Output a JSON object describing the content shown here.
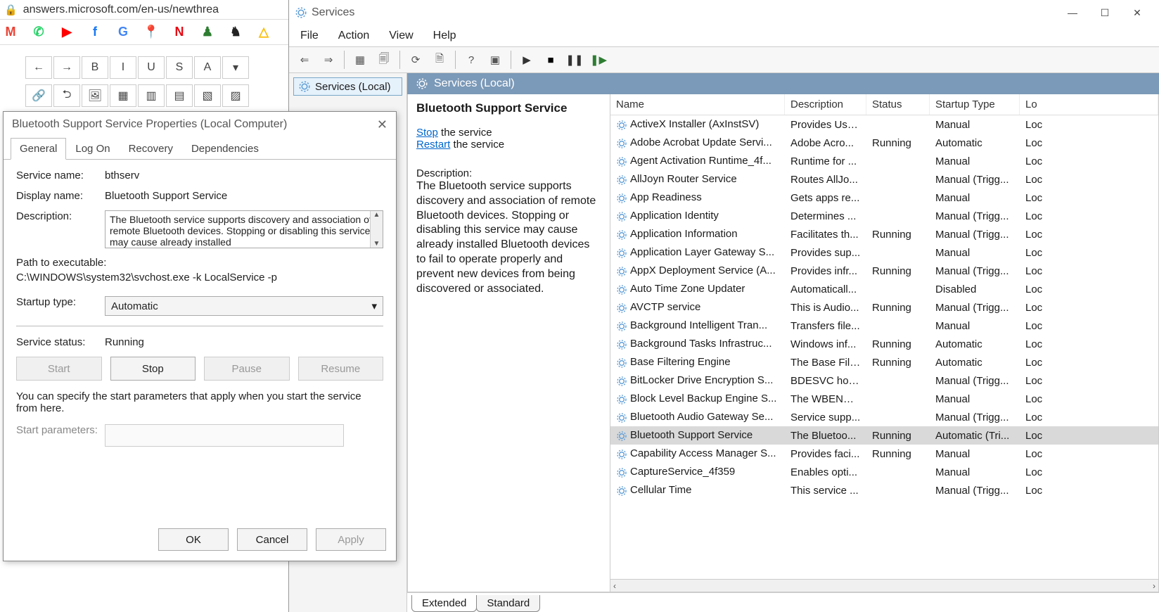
{
  "browser": {
    "url": "answers.microsoft.com/en-us/newthrea",
    "bookmarks": [
      {
        "name": "google-maps",
        "glyph": "M",
        "color": "#ea4335"
      },
      {
        "name": "whatsapp",
        "glyph": "✆",
        "color": "#25d366"
      },
      {
        "name": "youtube",
        "glyph": "▶",
        "color": "#ff0000"
      },
      {
        "name": "facebook",
        "glyph": "f",
        "color": "#1877f2"
      },
      {
        "name": "google-translate",
        "glyph": "G",
        "color": "#4285f4"
      },
      {
        "name": "maps-pin",
        "glyph": "📍",
        "color": "#ea4335"
      },
      {
        "name": "netflix",
        "glyph": "N",
        "color": "#e50914"
      },
      {
        "name": "chess-pawn",
        "glyph": "♟",
        "color": "#2e7d32"
      },
      {
        "name": "chess-knight",
        "glyph": "♞",
        "color": "#222"
      },
      {
        "name": "google-drive",
        "glyph": "△",
        "color": "#fbbc04"
      }
    ],
    "editor_toolbar": {
      "row1": [
        "←",
        "→",
        "B",
        "I",
        "U",
        "S",
        "A",
        "▾"
      ],
      "row2": [
        "🔗",
        "⮌",
        "🖼",
        "▦",
        "▥",
        "▤",
        "▧",
        "▨"
      ]
    }
  },
  "services_window": {
    "title": "Services",
    "menu": [
      "File",
      "Action",
      "View",
      "Help"
    ],
    "toolbar": [
      {
        "name": "back",
        "glyph": "⇐"
      },
      {
        "name": "forward",
        "glyph": "⇒"
      },
      {
        "sep": true
      },
      {
        "name": "show-hide-tree",
        "glyph": "▦"
      },
      {
        "name": "export-list",
        "glyph": "🗐"
      },
      {
        "sep": true
      },
      {
        "name": "refresh",
        "glyph": "⟳"
      },
      {
        "name": "properties",
        "glyph": "🗎"
      },
      {
        "sep": true
      },
      {
        "name": "help",
        "glyph": "?"
      },
      {
        "name": "action-pane",
        "glyph": "▣"
      },
      {
        "sep": true
      },
      {
        "name": "start",
        "glyph": "▶",
        "color": "#333"
      },
      {
        "name": "stop",
        "glyph": "■",
        "color": "#000"
      },
      {
        "name": "pause",
        "glyph": "❚❚",
        "color": "#333"
      },
      {
        "name": "restart",
        "glyph": "❚▶",
        "color": "#2e7d32"
      }
    ],
    "tree_node": "Services (Local)",
    "header": "Services (Local)",
    "detail": {
      "selected": "Bluetooth Support Service",
      "stop_link": "Stop",
      "stop_suffix": " the service",
      "restart_link": "Restart",
      "restart_suffix": " the service",
      "desc_label": "Description:",
      "desc_text": "The Bluetooth service supports discovery and association of remote Bluetooth devices.  Stopping or disabling this service may cause already installed Bluetooth devices to fail to operate properly and prevent new devices from being discovered or associated."
    },
    "columns": [
      "Name",
      "Description",
      "Status",
      "Startup Type",
      "Lo"
    ],
    "rows": [
      {
        "name": "ActiveX Installer (AxInstSV)",
        "desc": "Provides Use...",
        "status": "",
        "startup": "Manual",
        "log": "Loc"
      },
      {
        "name": "Adobe Acrobat Update Servi...",
        "desc": "Adobe Acro...",
        "status": "Running",
        "startup": "Automatic",
        "log": "Loc"
      },
      {
        "name": "Agent Activation Runtime_4f...",
        "desc": "Runtime for ...",
        "status": "",
        "startup": "Manual",
        "log": "Loc"
      },
      {
        "name": "AllJoyn Router Service",
        "desc": "Routes AllJo...",
        "status": "",
        "startup": "Manual (Trigg...",
        "log": "Loc"
      },
      {
        "name": "App Readiness",
        "desc": "Gets apps re...",
        "status": "",
        "startup": "Manual",
        "log": "Loc"
      },
      {
        "name": "Application Identity",
        "desc": "Determines ...",
        "status": "",
        "startup": "Manual (Trigg...",
        "log": "Loc"
      },
      {
        "name": "Application Information",
        "desc": "Facilitates th...",
        "status": "Running",
        "startup": "Manual (Trigg...",
        "log": "Loc"
      },
      {
        "name": "Application Layer Gateway S...",
        "desc": "Provides sup...",
        "status": "",
        "startup": "Manual",
        "log": "Loc"
      },
      {
        "name": "AppX Deployment Service (A...",
        "desc": "Provides infr...",
        "status": "Running",
        "startup": "Manual (Trigg...",
        "log": "Loc"
      },
      {
        "name": "Auto Time Zone Updater",
        "desc": "Automaticall...",
        "status": "",
        "startup": "Disabled",
        "log": "Loc"
      },
      {
        "name": "AVCTP service",
        "desc": "This is Audio...",
        "status": "Running",
        "startup": "Manual (Trigg...",
        "log": "Loc"
      },
      {
        "name": "Background Intelligent Tran...",
        "desc": "Transfers file...",
        "status": "",
        "startup": "Manual",
        "log": "Loc"
      },
      {
        "name": "Background Tasks Infrastruc...",
        "desc": "Windows inf...",
        "status": "Running",
        "startup": "Automatic",
        "log": "Loc"
      },
      {
        "name": "Base Filtering Engine",
        "desc": "The Base Filt...",
        "status": "Running",
        "startup": "Automatic",
        "log": "Loc"
      },
      {
        "name": "BitLocker Drive Encryption S...",
        "desc": "BDESVC hos...",
        "status": "",
        "startup": "Manual (Trigg...",
        "log": "Loc"
      },
      {
        "name": "Block Level Backup Engine S...",
        "desc": "The WBENGI...",
        "status": "",
        "startup": "Manual",
        "log": "Loc"
      },
      {
        "name": "Bluetooth Audio Gateway Se...",
        "desc": "Service supp...",
        "status": "",
        "startup": "Manual (Trigg...",
        "log": "Loc"
      },
      {
        "name": "Bluetooth Support Service",
        "desc": "The Bluetoo...",
        "status": "Running",
        "startup": "Automatic (Tri...",
        "log": "Loc",
        "selected": true
      },
      {
        "name": "Capability Access Manager S...",
        "desc": "Provides faci...",
        "status": "Running",
        "startup": "Manual",
        "log": "Loc"
      },
      {
        "name": "CaptureService_4f359",
        "desc": "Enables opti...",
        "status": "",
        "startup": "Manual",
        "log": "Loc"
      },
      {
        "name": "Cellular Time",
        "desc": "This service ...",
        "status": "",
        "startup": "Manual (Trigg...",
        "log": "Loc"
      }
    ],
    "tabs": [
      "Extended",
      "Standard"
    ],
    "active_tab": "Extended"
  },
  "properties_dialog": {
    "title": "Bluetooth Support Service Properties (Local Computer)",
    "tabs": [
      "General",
      "Log On",
      "Recovery",
      "Dependencies"
    ],
    "active_tab": "General",
    "service_name_lbl": "Service name:",
    "service_name": "bthserv",
    "display_name_lbl": "Display name:",
    "display_name": "Bluetooth Support Service",
    "description_lbl": "Description:",
    "description": "The Bluetooth service supports discovery and association of remote Bluetooth devices.  Stopping or disabling this service may cause already installed",
    "path_lbl": "Path to executable:",
    "path": "C:\\WINDOWS\\system32\\svchost.exe -k LocalService -p",
    "startup_lbl": "Startup type:",
    "startup_value": "Automatic",
    "status_lbl": "Service status:",
    "status_value": "Running",
    "buttons": {
      "start": "Start",
      "stop": "Stop",
      "pause": "Pause",
      "resume": "Resume"
    },
    "start_params_hint": "You can specify the start parameters that apply when you start the service from here.",
    "start_params_lbl": "Start parameters:",
    "dlg_buttons": {
      "ok": "OK",
      "cancel": "Cancel",
      "apply": "Apply"
    }
  }
}
